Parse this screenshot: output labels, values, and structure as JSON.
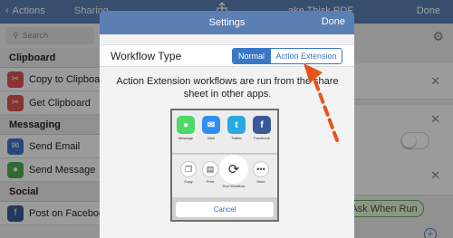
{
  "topbar": {
    "back_label": "Actions",
    "sharing_label": "Sharing",
    "doc_label": "ake Thisk PDF",
    "done_label": "Done"
  },
  "left": {
    "search_placeholder": "Search",
    "sections": [
      {
        "title": "Clipboard",
        "items": [
          {
            "label": "Copy to Clipboard",
            "icon": "scissors-icon",
            "color": "#d9534f"
          },
          {
            "label": "Get Clipboard",
            "icon": "scissors-icon",
            "color": "#d9534f"
          }
        ]
      },
      {
        "title": "Messaging",
        "items": [
          {
            "label": "Send Email",
            "icon": "mail-icon",
            "color": "#3a77c6"
          },
          {
            "label": "Send Message",
            "icon": "message-icon",
            "color": "#4caf50"
          }
        ]
      },
      {
        "title": "Social",
        "items": [
          {
            "label": "Post on Facebook",
            "icon": "facebook-icon",
            "color": "#3b5998"
          }
        ]
      }
    ]
  },
  "right": {
    "ask_when_run_label": "Ask When Run"
  },
  "modal": {
    "title": "Settings",
    "done_label": "Done",
    "workflow_type_label": "Workflow Type",
    "segments": [
      "Normal",
      "Action Extension"
    ],
    "selected_segment": "Normal",
    "description": "Action Extension workflows are run from the share sheet in other apps."
  },
  "share_sheet": {
    "apps": [
      {
        "label": "Message",
        "color": "#4cd964",
        "glyph": "●"
      },
      {
        "label": "Mail",
        "color": "#2f8ef0",
        "glyph": "✉"
      },
      {
        "label": "Twitter",
        "color": "#29a9e1",
        "glyph": "t"
      },
      {
        "label": "Facebook",
        "color": "#3b5998",
        "glyph": "f"
      }
    ],
    "actions": [
      {
        "label": "Copy",
        "glyph": "❐"
      },
      {
        "label": "Print",
        "glyph": "▤"
      },
      {
        "label": "Run Workflow",
        "glyph": "⟳"
      },
      {
        "label": "More",
        "glyph": "•••"
      }
    ],
    "cancel_label": "Cancel"
  },
  "colors": {
    "accent": "#3a77c6",
    "header": "#5b7fb3",
    "arrow": "#e8531c"
  }
}
